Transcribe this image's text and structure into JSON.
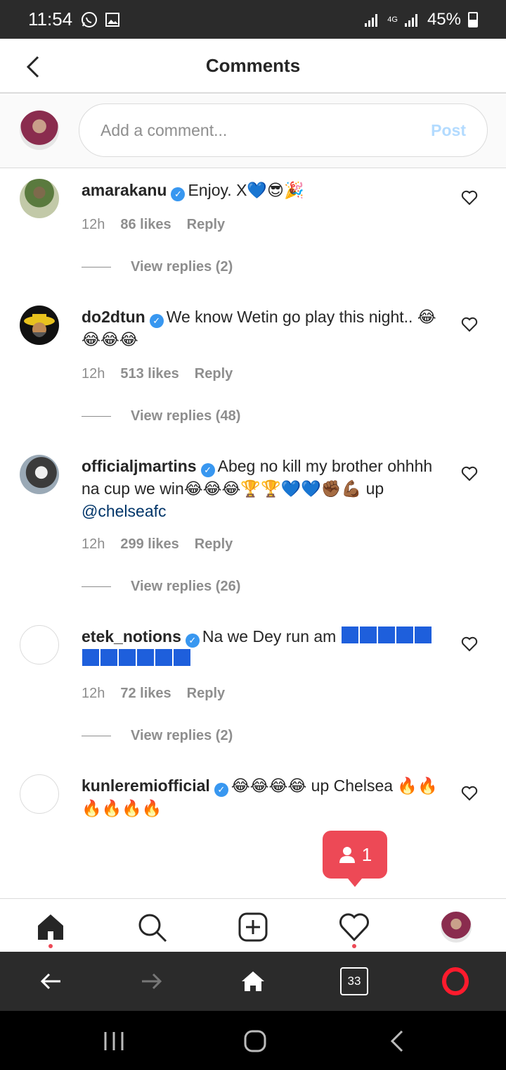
{
  "status_bar": {
    "time": "11:54",
    "network": "4G",
    "battery": "45%"
  },
  "header": {
    "title": "Comments"
  },
  "composer": {
    "placeholder": "Add a comment...",
    "post_label": "Post"
  },
  "comments": [
    {
      "username": "amarakanu",
      "text": "Enjoy. X💙😎🎉",
      "time": "12h",
      "likes": "86 likes",
      "reply_label": "Reply",
      "view_replies": "View replies (2)"
    },
    {
      "username": "do2dtun",
      "text": "We know Wetin go play this night.. 😂😂😂😂",
      "time": "12h",
      "likes": "513 likes",
      "reply_label": "Reply",
      "view_replies": "View replies (48)"
    },
    {
      "username": "officialjmartins",
      "text": "Abeg no kill my brother ohhhh na cup we win😂😂😂🏆🏆💙💙✊🏾💪🏾 up",
      "mention": "@chelseafc",
      "time": "12h",
      "likes": "299 likes",
      "reply_label": "Reply",
      "view_replies": "View replies (26)"
    },
    {
      "username": "etek_notions",
      "text": "Na we Dey run am",
      "time": "12h",
      "likes": "72 likes",
      "reply_label": "Reply",
      "view_replies": "View replies (2)"
    },
    {
      "username": "kunleremiofficial",
      "text": "😂😂😂😂 up Chelsea 🔥🔥🔥🔥🔥🔥"
    }
  ],
  "activity_badge": {
    "count": "1"
  },
  "browser": {
    "tab_count": "33"
  },
  "colors": {
    "accent": "#3897f0",
    "post_disabled": "#b3dbff",
    "notification": "#ed4956"
  },
  "icons": [
    "back-arrow-icon",
    "heart-outline-icon",
    "verified-badge-icon",
    "home-icon",
    "search-icon",
    "new-post-icon",
    "activity-heart-icon",
    "opera-icon"
  ]
}
